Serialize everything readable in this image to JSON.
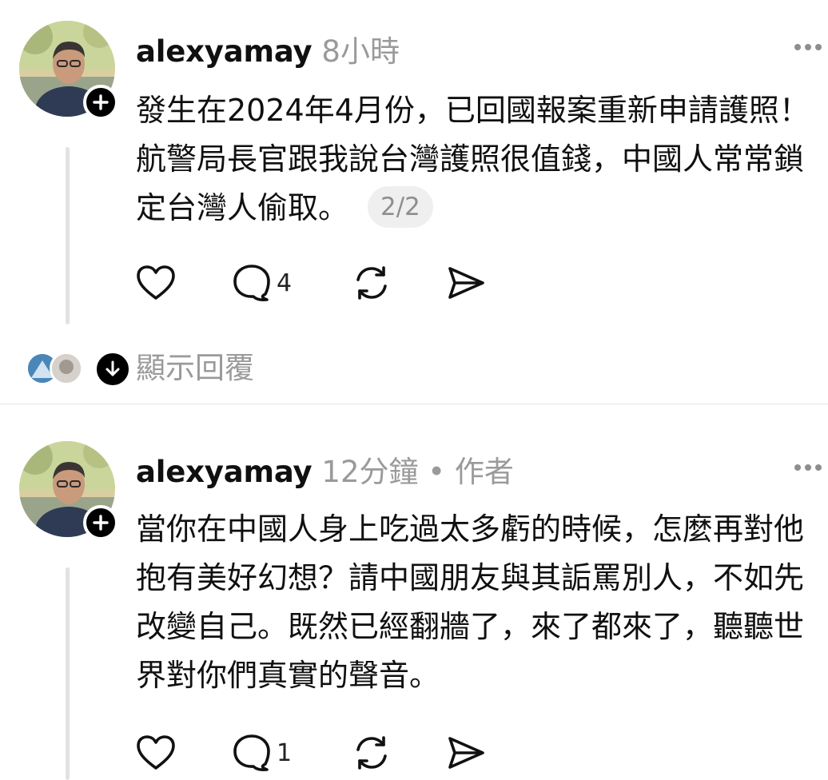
{
  "posts": [
    {
      "username": "alexyamay",
      "meta": "8小時",
      "text": "發生在2024年4月份，已回國報案重新申請護照！航警局長官跟我說台灣護照很值錢，中國人常常鎖定台灣人偷取。",
      "page_indicator": "2/2",
      "reply_count": "4",
      "show_replies_label": "顯示回覆"
    },
    {
      "username": "alexyamay",
      "meta": "12分鐘 • 作者",
      "text": "當你在中國人身上吃過太多虧的時候，怎麼再對他抱有美好幻想？請中國朋友與其詬罵別人，不如先改變自己。既然已經翻牆了，來了都來了，聽聽世界對你們真實的聲音。",
      "reply_count": "1"
    }
  ],
  "colors": {
    "text": "#101010",
    "muted": "#9a9a9a",
    "thread_line": "#e2e2e2",
    "pill_bg": "#efefef"
  },
  "icons": [
    "more-icon",
    "plus-icon",
    "heart-icon",
    "comment-icon",
    "repost-icon",
    "share-icon",
    "arrow-down-icon"
  ]
}
